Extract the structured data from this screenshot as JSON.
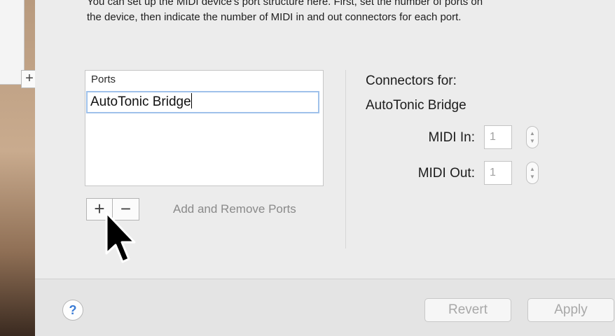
{
  "intro": {
    "line1": "You can set up the MIDI device's port structure here.  First, set the number of ports on",
    "line2": "the device, then indicate the number of MIDI in and out connectors for each port."
  },
  "background_window": {
    "plus_label": "+"
  },
  "ports": {
    "header": "Ports",
    "items": [
      "AutoTonic Bridge"
    ],
    "add_label": "+",
    "remove_label": "−",
    "caption": "Add and Remove Ports"
  },
  "connectors": {
    "title": "Connectors for:",
    "device": "AutoTonic Bridge",
    "midi_in_label": "MIDI In:",
    "midi_in_value": "1",
    "midi_out_label": "MIDI Out:",
    "midi_out_value": "1"
  },
  "footer": {
    "help_label": "?",
    "revert_label": "Revert",
    "apply_label": "Apply"
  },
  "colors": {
    "panel_bg": "#ececec",
    "selection_border": "#9fc1ea",
    "help_accent": "#3a7bd5",
    "disabled_text": "#a8a8a8"
  },
  "icons": {
    "cursor": "arrow-pointer-icon",
    "stepper": "up-down-stepper-icon"
  }
}
